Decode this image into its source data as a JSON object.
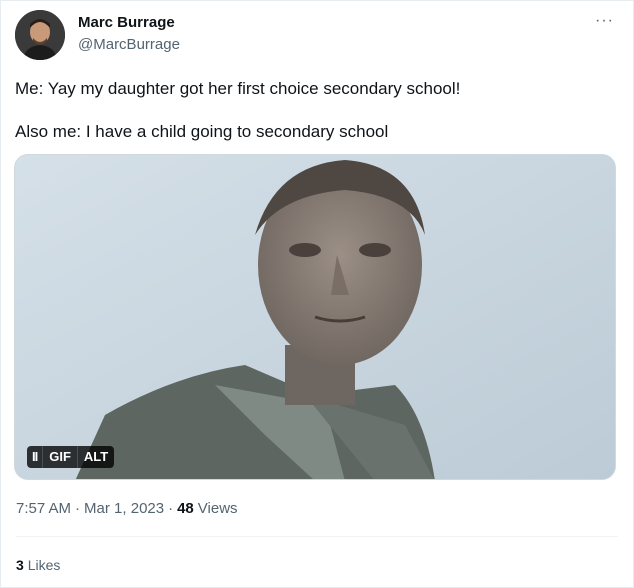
{
  "author": {
    "name": "Marc Burrage",
    "handle": "@MarcBurrage",
    "more_label": "···"
  },
  "tweet": {
    "line1": "Me: Yay my daughter got her first choice secondary school!",
    "line2": "Also me: I have a child going to secondary school"
  },
  "media": {
    "type": "gif",
    "badges": {
      "pause": "II",
      "gif": "GIF",
      "alt": "ALT"
    }
  },
  "meta": {
    "time": "7:57 AM",
    "sep1": "·",
    "date": "Mar 1, 2023",
    "sep2": "·",
    "views_count": "48",
    "views_label": "Views"
  },
  "engagement": {
    "likes_count": "3",
    "likes_label": "Likes"
  },
  "icons": {
    "more": "more-horizontal-icon",
    "pause": "pause-icon"
  },
  "colors": {
    "text_primary": "#0f1419",
    "text_secondary": "#536471",
    "border": "#cfd9de"
  }
}
